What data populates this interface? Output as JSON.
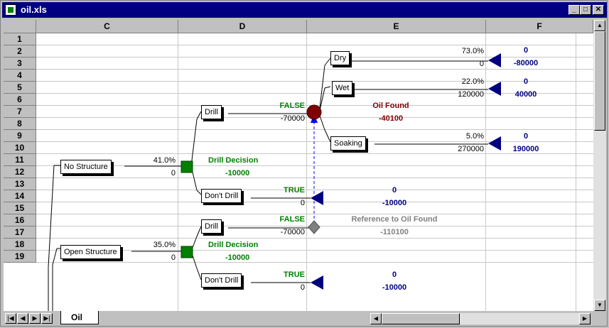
{
  "window": {
    "title": "oil.xls"
  },
  "columns": [
    "C",
    "D",
    "E",
    "F"
  ],
  "rows": [
    "1",
    "2",
    "3",
    "4",
    "5",
    "6",
    "7",
    "8",
    "9",
    "10",
    "11",
    "12",
    "13",
    "14",
    "15",
    "16",
    "17",
    "18",
    "19"
  ],
  "sheet_tab": "Oil",
  "tree": {
    "no_structure": {
      "label": "No Structure",
      "prob": "41.0%",
      "value": "0"
    },
    "decision1": {
      "name": "Drill Decision",
      "value": "-10000"
    },
    "drill1": {
      "label": "Drill",
      "flag": "FALSE",
      "cost": "-70000"
    },
    "oil_found": {
      "name": "Oil Found",
      "value": "-40100"
    },
    "dry": {
      "label": "Dry",
      "prob": "73.0%",
      "value": "0",
      "payoff": "0",
      "total": "-80000"
    },
    "wet": {
      "label": "Wet",
      "prob": "22.0%",
      "value": "120000",
      "payoff": "0",
      "total": "40000"
    },
    "soaking": {
      "label": "Soaking",
      "prob": "5.0%",
      "value": "270000",
      "payoff": "0",
      "total": "190000"
    },
    "dont_drill1": {
      "label": "Don't Drill",
      "flag": "TRUE",
      "value": "0",
      "payoff": "0",
      "total": "-10000"
    },
    "open_structure": {
      "label": "Open Structure",
      "prob": "35.0%",
      "value": "0"
    },
    "decision2": {
      "name": "Drill Decision",
      "value": "-10000"
    },
    "drill2": {
      "label": "Drill",
      "flag": "FALSE",
      "cost": "-70000"
    },
    "ref_node": {
      "name": "Reference to Oil Found",
      "value": "-110100"
    },
    "dont_drill2": {
      "label": "Don't Drill",
      "flag": "TRUE",
      "value": "0",
      "payoff": "0",
      "total": "-10000"
    }
  },
  "colors": {
    "green": "#008000",
    "navy": "#000080",
    "maroon": "#800000",
    "gray": "#808080",
    "titlebar": "#000080"
  }
}
